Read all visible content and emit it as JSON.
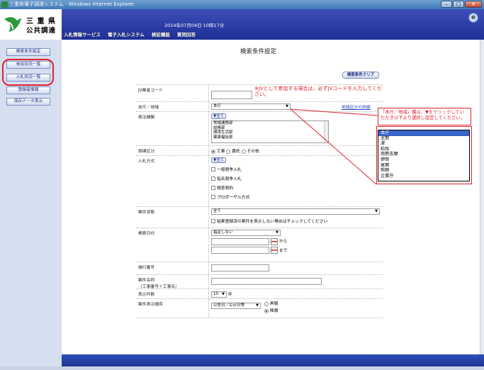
{
  "window": {
    "title": "三重県電子調達システム - Windows Internet Explorer"
  },
  "header": {
    "logo_line1": "三 重 県",
    "logo_line2": "公共調達",
    "datetime": "2014年07月04日 10時17分",
    "nav": [
      "入札情報サービス",
      "電子入札システム",
      "検証機能",
      "質問回答"
    ]
  },
  "sidebar": {
    "items": [
      "検索条件設定",
      "参加状況一覧",
      "入札状況一覧",
      "登録者情報",
      "保存データ表示"
    ]
  },
  "main": {
    "title": "検索条件設定",
    "clear_label": "検索条件クリア",
    "jv": {
      "label": "JV業者コード",
      "note": "※JVとして参加する場合は、必ずJVコードを入力してください。"
    },
    "region": {
      "label": "本庁／地域",
      "value": "本庁",
      "link": "地域区分の詳細"
    },
    "agency": {
      "label": "発注機関",
      "all": "▼全て",
      "options": [
        "地域連携部",
        "総務部",
        "環境生活部",
        "健康福祉部"
      ]
    },
    "category": {
      "label": "調達区分",
      "options": [
        "工事",
        "委託",
        "その他"
      ]
    },
    "method": {
      "label": "入札方式",
      "all": "▼全て",
      "options": [
        "一般競争入札",
        "指名競争入札",
        "随意契約",
        "プロポーザル方式"
      ]
    },
    "status": {
      "label": "案件状態",
      "value": "全て",
      "check": "結果登録済の案件を表示しない場合はチェックしてください"
    },
    "date": {
      "label": "検索日付",
      "value": "指定しない",
      "from": "から",
      "to": "まで"
    },
    "exec_no": {
      "label": "施行番号"
    },
    "name": {
      "label1": "案件名称",
      "label2": "（工事番号＋工事名）"
    },
    "count": {
      "label": "表示件数",
      "value": "10",
      "unit": "件"
    },
    "order": {
      "label": "案件表示順序",
      "value": "公告日／公示日等",
      "asc": "昇順",
      "desc": "降順"
    }
  },
  "callout": {
    "note": "「本庁／地域」欄は、▼をクリックしていただき以下より選択し設定してください。",
    "options": [
      "本庁",
      "北勢",
      "津",
      "松阪",
      "南勢志摩",
      "伊賀",
      "尾鷲",
      "熊野",
      "企業庁"
    ],
    "selected": "本庁"
  }
}
